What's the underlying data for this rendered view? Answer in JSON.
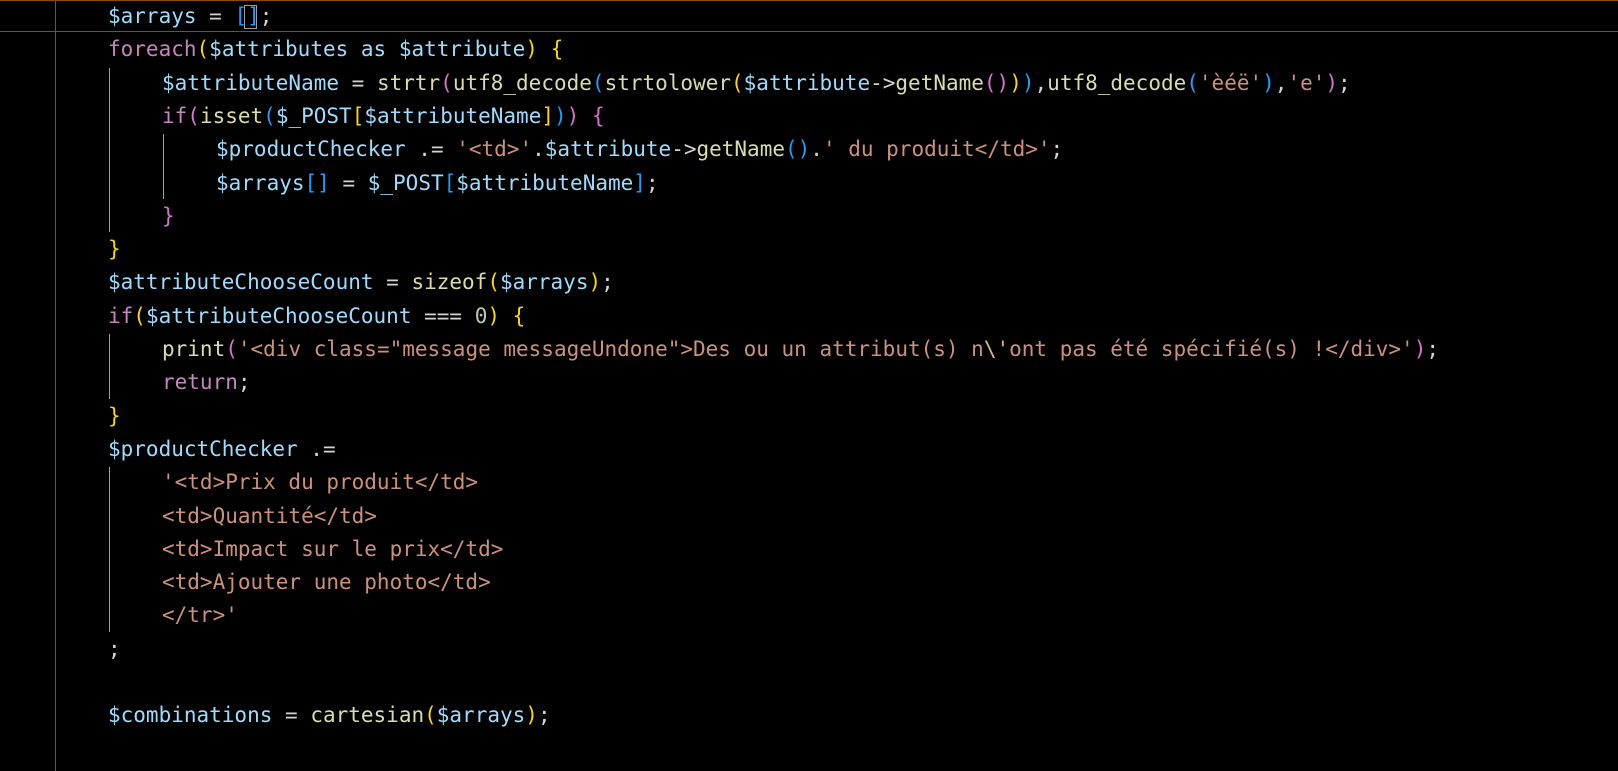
{
  "editor": {
    "colors": {
      "background": "#000000",
      "variable": "#9cdcfe",
      "function": "#dcdcaa",
      "keyword": "#c586c0",
      "string": "#ce9178",
      "bracket_level_1": "#ffd700",
      "bracket_level_2": "#da70d6",
      "bracket_level_3": "#179fff",
      "current_line_border": "#8a4a0a"
    },
    "lines": [
      [
        [
          "var",
          "$arrays"
        ],
        [
          "op",
          " = "
        ],
        [
          "b3",
          "["
        ],
        [
          "b3",
          "]"
        ],
        [
          "op",
          ";"
        ]
      ],
      [
        [
          "kw",
          "foreach"
        ],
        [
          "b1",
          "("
        ],
        [
          "var",
          "$attributes"
        ],
        [
          "op",
          " "
        ],
        [
          "var",
          "as"
        ],
        [
          "op",
          " "
        ],
        [
          "var",
          "$attribute"
        ],
        [
          "b1",
          ")"
        ],
        [
          "op",
          " "
        ],
        [
          "b1",
          "{"
        ]
      ],
      [
        [
          "var",
          "$attributeName"
        ],
        [
          "op",
          " = "
        ],
        [
          "fn",
          "strtr"
        ],
        [
          "b2",
          "("
        ],
        [
          "fn",
          "utf8_decode"
        ],
        [
          "b3",
          "("
        ],
        [
          "fn",
          "strtolower"
        ],
        [
          "b1",
          "("
        ],
        [
          "var",
          "$attribute"
        ],
        [
          "op",
          "->"
        ],
        [
          "fn",
          "getName"
        ],
        [
          "b2",
          "()"
        ],
        [
          "b1",
          ")"
        ],
        [
          "b3",
          ")"
        ],
        [
          "op",
          ","
        ],
        [
          "fn",
          "utf8_decode"
        ],
        [
          "b3",
          "("
        ],
        [
          "str",
          "'èéë'"
        ],
        [
          "b3",
          ")"
        ],
        [
          "op",
          ","
        ],
        [
          "str",
          "'e'"
        ],
        [
          "b2",
          ")"
        ],
        [
          "op",
          ";"
        ]
      ],
      [
        [
          "kw",
          "if"
        ],
        [
          "b2",
          "("
        ],
        [
          "fn",
          "isset"
        ],
        [
          "b3",
          "("
        ],
        [
          "var",
          "$_POST"
        ],
        [
          "b1",
          "["
        ],
        [
          "var",
          "$attributeName"
        ],
        [
          "b1",
          "]"
        ],
        [
          "b3",
          ")"
        ],
        [
          "b2",
          ")"
        ],
        [
          "op",
          " "
        ],
        [
          "b2",
          "{"
        ]
      ],
      [
        [
          "var",
          "$productChecker"
        ],
        [
          "op",
          " .= "
        ],
        [
          "str",
          "'<td>'"
        ],
        [
          "op",
          "."
        ],
        [
          "var",
          "$attribute"
        ],
        [
          "op",
          "->"
        ],
        [
          "fn",
          "getName"
        ],
        [
          "b3",
          "()"
        ],
        [
          "op",
          "."
        ],
        [
          "str",
          "' du produit</td>'"
        ],
        [
          "op",
          ";"
        ]
      ],
      [
        [
          "var",
          "$arrays"
        ],
        [
          "b3",
          "[]"
        ],
        [
          "op",
          " = "
        ],
        [
          "var",
          "$_POST"
        ],
        [
          "b3",
          "["
        ],
        [
          "var",
          "$attributeName"
        ],
        [
          "b3",
          "]"
        ],
        [
          "op",
          ";"
        ]
      ],
      [
        [
          "b2",
          "}"
        ]
      ],
      [
        [
          "b1",
          "}"
        ]
      ],
      [
        [
          "var",
          "$attributeChooseCount"
        ],
        [
          "op",
          " = "
        ],
        [
          "fn",
          "sizeof"
        ],
        [
          "b1",
          "("
        ],
        [
          "var",
          "$arrays"
        ],
        [
          "b1",
          ")"
        ],
        [
          "op",
          ";"
        ]
      ],
      [
        [
          "kw",
          "if"
        ],
        [
          "b1",
          "("
        ],
        [
          "var",
          "$attributeChooseCount"
        ],
        [
          "op",
          " === "
        ],
        [
          "num",
          "0"
        ],
        [
          "b1",
          ")"
        ],
        [
          "op",
          " "
        ],
        [
          "b1",
          "{"
        ]
      ],
      [
        [
          "fn",
          "print"
        ],
        [
          "b2",
          "("
        ],
        [
          "str",
          "'<div class=\"message messageUndone\">Des ou un attribut(s) n"
        ],
        [
          "esc",
          "\\'"
        ],
        [
          "str",
          "ont pas été spécifié(s) !</div>'"
        ],
        [
          "b2",
          ")"
        ],
        [
          "op",
          ";"
        ]
      ],
      [
        [
          "kw",
          "return"
        ],
        [
          "op",
          ";"
        ]
      ],
      [
        [
          "b1",
          "}"
        ]
      ],
      [
        [
          "var",
          "$productChecker"
        ],
        [
          "op",
          " .="
        ]
      ],
      [
        [
          "str",
          "'<td>Prix du produit</td>"
        ]
      ],
      [
        [
          "str",
          "<td>Quantité</td>"
        ]
      ],
      [
        [
          "str",
          "<td>Impact sur le prix</td>"
        ]
      ],
      [
        [
          "str",
          "<td>Ajouter une photo</td>"
        ]
      ],
      [
        [
          "str",
          "</tr>'"
        ]
      ],
      [
        [
          "op",
          ";"
        ]
      ],
      [],
      [
        [
          "var",
          "$combinations"
        ],
        [
          "op",
          " = "
        ],
        [
          "fn",
          "cartesian"
        ],
        [
          "b1",
          "("
        ],
        [
          "var",
          "$arrays"
        ],
        [
          "b1",
          ")"
        ],
        [
          "op",
          ";"
        ]
      ]
    ],
    "indents": [
      0,
      0,
      1,
      1,
      2,
      2,
      1,
      0,
      0,
      0,
      1,
      1,
      0,
      0,
      1,
      1,
      1,
      1,
      1,
      0,
      0,
      0
    ]
  }
}
